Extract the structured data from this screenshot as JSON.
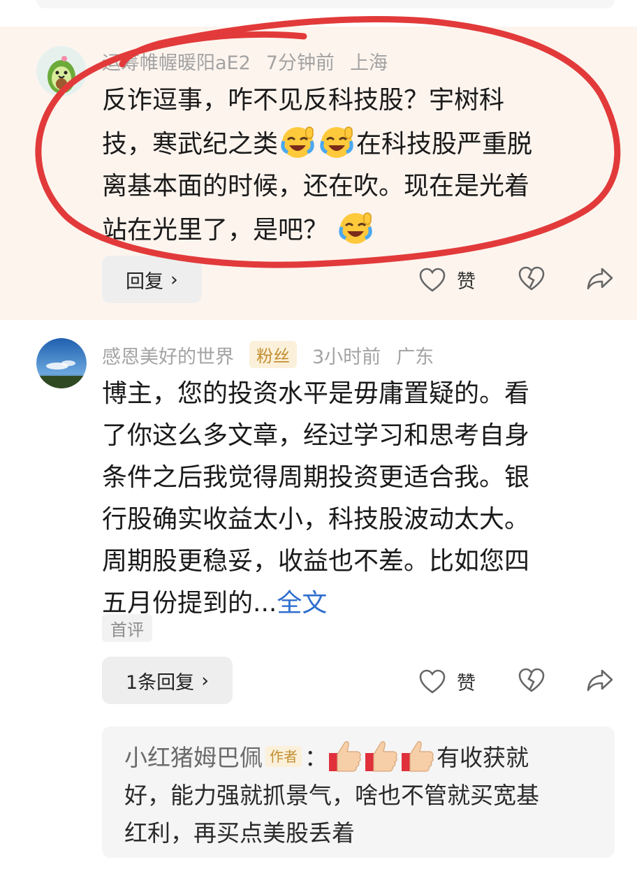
{
  "comment1": {
    "username": "运筹帷幄暖阳aE2",
    "time": "7分钟前",
    "location": "上海",
    "lines": [
      "反诈逗事，咋不见反科技股？宇树科",
      "技，寒武纪之类",
      "在科技股严重脱",
      "离基本面的时候，还在吹。现在是光着",
      "站在光里了，是吧？"
    ],
    "reply_label": "回复",
    "like_label": "赞",
    "avatar_icon": "avocado-avatar",
    "emoji_icon": "laughing-crying-emoji"
  },
  "comment2": {
    "username": "感恩美好的世界",
    "badge": "粉丝",
    "time": "3小时前",
    "location": "广东",
    "lines": [
      "博主，您的投资水平是毋庸置疑的。看",
      "了你这么多文章，经过学习和思考自身",
      "条件之后我觉得周期投资更适合我。银",
      "行股确实收益太小，科技股波动太大。",
      "周期股更稳妥，收益也不差。比如您四",
      "五月份提到的..."
    ],
    "more_link": "全文",
    "tag": "首评",
    "reply_label": "1条回复",
    "like_label": "赞",
    "avatar_icon": "sky-landscape-avatar"
  },
  "sub_reply": {
    "name": "小红猪姆巴佩",
    "badge": "作者",
    "colon": "：",
    "line1_text": "有收获就",
    "line2": "好，能力强就抓景气，啥也不管就买宽基",
    "line3": "红利，再买点美股丢着",
    "thumb_icon": "thumbs-up-emoji"
  },
  "colors": {
    "highlight_bg": "#fdf4ee",
    "annotation_red": "#e23a3a",
    "link_blue": "#2f6fce",
    "badge_gold": "#c28e30"
  }
}
